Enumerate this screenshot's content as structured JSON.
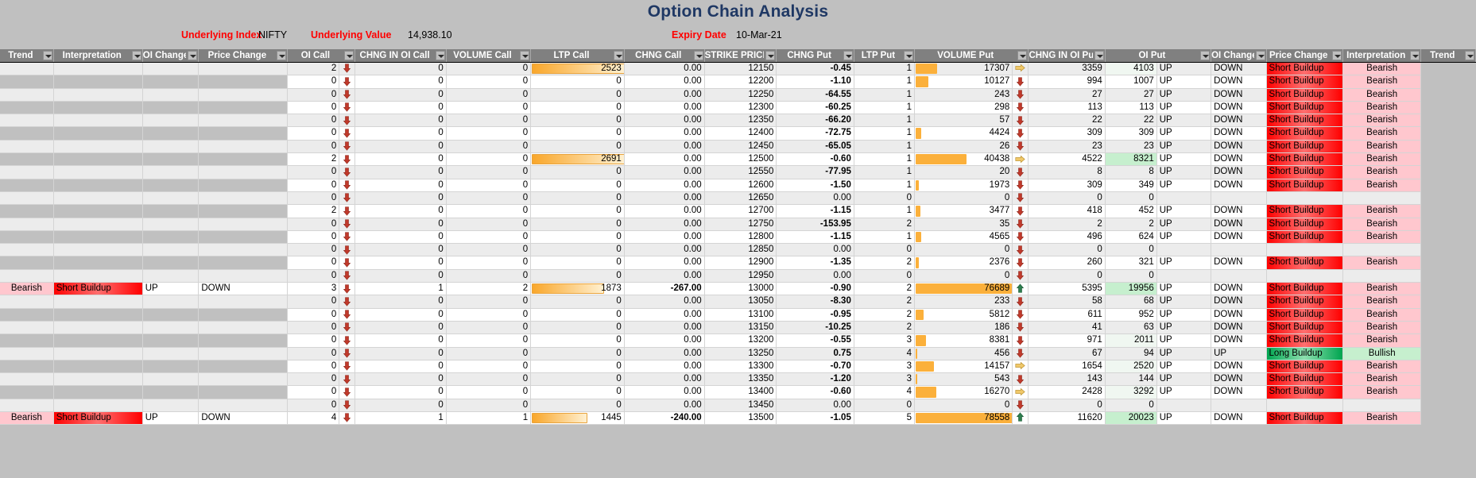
{
  "header": {
    "title": "Option Chain Analysis",
    "underlying_index_label": "Underlying Index",
    "underlying_index_value": "NIFTY",
    "underlying_value_label": "Underlying Value",
    "underlying_value": "14,938.10",
    "expiry_date_label": "Expiry Date",
    "expiry_date_value": "10-Mar-21",
    "title_color": "#1f3864",
    "label_color": "#ff0000"
  },
  "columns": [
    "Trend",
    "Interpretation",
    "OI Change",
    "Price Change",
    "OI Call",
    "CHNG IN OI Call",
    "VOLUME Call",
    "LTP Call",
    "CHNG Call",
    "STRIKE PRICE",
    "CHNG Put",
    "LTP Put",
    "VOLUME Put",
    "CHNG IN OI Put",
    "OI Put",
    "OI Change",
    "Price Change",
    "Interpretation",
    "Trend"
  ],
  "legend": {
    "up_arrow": "up-arrow-icon",
    "down_arrow": "down-arrow-icon",
    "flat_arrow": "flat-arrow-icon"
  },
  "rows": [
    {
      "strike": "12150",
      "l_trend": "",
      "l_interp": "",
      "l_oichg": "",
      "l_pricechg": "",
      "oi_call": "2",
      "oi_call_arrow": "down",
      "chng_oi_call": "0",
      "vol_call": "0",
      "ltp_call": "2523",
      "ltp_call_bar": 100,
      "chng_call": "0.00",
      "chng_put": "-0.45",
      "chng_put_sign": "neg",
      "ltp_put": "1",
      "vol_put": "17307",
      "vol_put_bar": 22,
      "vol_put_arrow": "flat",
      "chng_oi_put": "3359",
      "oi_put": "4103",
      "oi_put_hl": "faint",
      "r_oichg": "UP",
      "r_pricechg": "DOWN",
      "r_interp": "Short Buildup",
      "r_trend": "Bearish"
    },
    {
      "strike": "12200",
      "l_trend": "",
      "l_interp": "",
      "l_oichg": "",
      "l_pricechg": "",
      "oi_call": "0",
      "oi_call_arrow": "down",
      "chng_oi_call": "0",
      "vol_call": "0",
      "ltp_call": "0",
      "ltp_call_bar": 0,
      "chng_call": "0.00",
      "chng_put": "-1.10",
      "chng_put_sign": "neg",
      "ltp_put": "1",
      "vol_put": "10127",
      "vol_put_bar": 13,
      "vol_put_arrow": "down",
      "chng_oi_put": "994",
      "oi_put": "1007",
      "oi_put_hl": "none",
      "r_oichg": "UP",
      "r_pricechg": "DOWN",
      "r_interp": "Short Buildup",
      "r_trend": "Bearish"
    },
    {
      "strike": "12250",
      "l_trend": "",
      "l_interp": "",
      "l_oichg": "",
      "l_pricechg": "",
      "oi_call": "0",
      "oi_call_arrow": "down",
      "chng_oi_call": "0",
      "vol_call": "0",
      "ltp_call": "0",
      "ltp_call_bar": 0,
      "chng_call": "0.00",
      "chng_put": "-64.55",
      "chng_put_sign": "neg",
      "ltp_put": "1",
      "vol_put": "243",
      "vol_put_bar": 0,
      "vol_put_arrow": "down",
      "chng_oi_put": "27",
      "oi_put": "27",
      "oi_put_hl": "none",
      "r_oichg": "UP",
      "r_pricechg": "DOWN",
      "r_interp": "Short Buildup",
      "r_trend": "Bearish"
    },
    {
      "strike": "12300",
      "l_trend": "",
      "l_interp": "",
      "l_oichg": "",
      "l_pricechg": "",
      "oi_call": "0",
      "oi_call_arrow": "down",
      "chng_oi_call": "0",
      "vol_call": "0",
      "ltp_call": "0",
      "ltp_call_bar": 0,
      "chng_call": "0.00",
      "chng_put": "-60.25",
      "chng_put_sign": "neg",
      "ltp_put": "1",
      "vol_put": "298",
      "vol_put_bar": 0,
      "vol_put_arrow": "down",
      "chng_oi_put": "113",
      "oi_put": "113",
      "oi_put_hl": "none",
      "r_oichg": "UP",
      "r_pricechg": "DOWN",
      "r_interp": "Short Buildup",
      "r_trend": "Bearish"
    },
    {
      "strike": "12350",
      "l_trend": "",
      "l_interp": "",
      "l_oichg": "",
      "l_pricechg": "",
      "oi_call": "0",
      "oi_call_arrow": "down",
      "chng_oi_call": "0",
      "vol_call": "0",
      "ltp_call": "0",
      "ltp_call_bar": 0,
      "chng_call": "0.00",
      "chng_put": "-66.20",
      "chng_put_sign": "neg",
      "ltp_put": "1",
      "vol_put": "57",
      "vol_put_bar": 0,
      "vol_put_arrow": "down",
      "chng_oi_put": "22",
      "oi_put": "22",
      "oi_put_hl": "none",
      "r_oichg": "UP",
      "r_pricechg": "DOWN",
      "r_interp": "Short Buildup",
      "r_trend": "Bearish"
    },
    {
      "strike": "12400",
      "l_trend": "",
      "l_interp": "",
      "l_oichg": "",
      "l_pricechg": "",
      "oi_call": "0",
      "oi_call_arrow": "down",
      "chng_oi_call": "0",
      "vol_call": "0",
      "ltp_call": "0",
      "ltp_call_bar": 0,
      "chng_call": "0.00",
      "chng_put": "-72.75",
      "chng_put_sign": "neg",
      "ltp_put": "1",
      "vol_put": "4424",
      "vol_put_bar": 6,
      "vol_put_arrow": "down",
      "chng_oi_put": "309",
      "oi_put": "309",
      "oi_put_hl": "none",
      "r_oichg": "UP",
      "r_pricechg": "DOWN",
      "r_interp": "Short Buildup",
      "r_trend": "Bearish"
    },
    {
      "strike": "12450",
      "l_trend": "",
      "l_interp": "",
      "l_oichg": "",
      "l_pricechg": "",
      "oi_call": "0",
      "oi_call_arrow": "down",
      "chng_oi_call": "0",
      "vol_call": "0",
      "ltp_call": "0",
      "ltp_call_bar": 0,
      "chng_call": "0.00",
      "chng_put": "-65.05",
      "chng_put_sign": "neg",
      "ltp_put": "1",
      "vol_put": "26",
      "vol_put_bar": 0,
      "vol_put_arrow": "down",
      "chng_oi_put": "23",
      "oi_put": "23",
      "oi_put_hl": "none",
      "r_oichg": "UP",
      "r_pricechg": "DOWN",
      "r_interp": "Short Buildup",
      "r_trend": "Bearish"
    },
    {
      "strike": "12500",
      "l_trend": "",
      "l_interp": "",
      "l_oichg": "",
      "l_pricechg": "",
      "oi_call": "2",
      "oi_call_arrow": "down",
      "chng_oi_call": "0",
      "vol_call": "0",
      "ltp_call": "2691",
      "ltp_call_bar": 100,
      "chng_call": "0.00",
      "chng_put": "-0.60",
      "chng_put_sign": "neg",
      "ltp_put": "1",
      "vol_put": "40438",
      "vol_put_bar": 52,
      "vol_put_arrow": "flat",
      "chng_oi_put": "4522",
      "oi_put": "8321",
      "oi_put_hl": "green",
      "r_oichg": "UP",
      "r_pricechg": "DOWN",
      "r_interp": "Short Buildup",
      "r_trend": "Bearish"
    },
    {
      "strike": "12550",
      "l_trend": "",
      "l_interp": "",
      "l_oichg": "",
      "l_pricechg": "",
      "oi_call": "0",
      "oi_call_arrow": "down",
      "chng_oi_call": "0",
      "vol_call": "0",
      "ltp_call": "0",
      "ltp_call_bar": 0,
      "chng_call": "0.00",
      "chng_put": "-77.95",
      "chng_put_sign": "neg",
      "ltp_put": "1",
      "vol_put": "20",
      "vol_put_bar": 0,
      "vol_put_arrow": "down",
      "chng_oi_put": "8",
      "oi_put": "8",
      "oi_put_hl": "none",
      "r_oichg": "UP",
      "r_pricechg": "DOWN",
      "r_interp": "Short Buildup",
      "r_trend": "Bearish"
    },
    {
      "strike": "12600",
      "l_trend": "",
      "l_interp": "",
      "l_oichg": "",
      "l_pricechg": "",
      "oi_call": "0",
      "oi_call_arrow": "down",
      "chng_oi_call": "0",
      "vol_call": "0",
      "ltp_call": "0",
      "ltp_call_bar": 0,
      "chng_call": "0.00",
      "chng_put": "-1.50",
      "chng_put_sign": "neg",
      "ltp_put": "1",
      "vol_put": "1973",
      "vol_put_bar": 3,
      "vol_put_arrow": "down",
      "chng_oi_put": "309",
      "oi_put": "349",
      "oi_put_hl": "none",
      "r_oichg": "UP",
      "r_pricechg": "DOWN",
      "r_interp": "Short Buildup",
      "r_trend": "Bearish"
    },
    {
      "strike": "12650",
      "l_trend": "",
      "l_interp": "",
      "l_oichg": "",
      "l_pricechg": "",
      "oi_call": "0",
      "oi_call_arrow": "down",
      "chng_oi_call": "0",
      "vol_call": "0",
      "ltp_call": "0",
      "ltp_call_bar": 0,
      "chng_call": "0.00",
      "chng_put": "0.00",
      "chng_put_sign": "zero",
      "ltp_put": "0",
      "vol_put": "0",
      "vol_put_bar": 0,
      "vol_put_arrow": "down",
      "chng_oi_put": "0",
      "oi_put": "0",
      "oi_put_hl": "none",
      "r_oichg": "",
      "r_pricechg": "",
      "r_interp": "",
      "r_trend": ""
    },
    {
      "strike": "12700",
      "l_trend": "",
      "l_interp": "",
      "l_oichg": "",
      "l_pricechg": "",
      "oi_call": "2",
      "oi_call_arrow": "down",
      "chng_oi_call": "0",
      "vol_call": "0",
      "ltp_call": "0",
      "ltp_call_bar": 0,
      "chng_call": "0.00",
      "chng_put": "-1.15",
      "chng_put_sign": "neg",
      "ltp_put": "1",
      "vol_put": "3477",
      "vol_put_bar": 5,
      "vol_put_arrow": "down",
      "chng_oi_put": "418",
      "oi_put": "452",
      "oi_put_hl": "none",
      "r_oichg": "UP",
      "r_pricechg": "DOWN",
      "r_interp": "Short Buildup",
      "r_trend": "Bearish"
    },
    {
      "strike": "12750",
      "l_trend": "",
      "l_interp": "",
      "l_oichg": "",
      "l_pricechg": "",
      "oi_call": "0",
      "oi_call_arrow": "down",
      "chng_oi_call": "0",
      "vol_call": "0",
      "ltp_call": "0",
      "ltp_call_bar": 0,
      "chng_call": "0.00",
      "chng_put": "-153.95",
      "chng_put_sign": "neg",
      "ltp_put": "2",
      "vol_put": "35",
      "vol_put_bar": 0,
      "vol_put_arrow": "down",
      "chng_oi_put": "2",
      "oi_put": "2",
      "oi_put_hl": "none",
      "r_oichg": "UP",
      "r_pricechg": "DOWN",
      "r_interp": "Short Buildup",
      "r_trend": "Bearish"
    },
    {
      "strike": "12800",
      "l_trend": "",
      "l_interp": "",
      "l_oichg": "",
      "l_pricechg": "",
      "oi_call": "0",
      "oi_call_arrow": "down",
      "chng_oi_call": "0",
      "vol_call": "0",
      "ltp_call": "0",
      "ltp_call_bar": 0,
      "chng_call": "0.00",
      "chng_put": "-1.15",
      "chng_put_sign": "neg",
      "ltp_put": "1",
      "vol_put": "4565",
      "vol_put_bar": 6,
      "vol_put_arrow": "down",
      "chng_oi_put": "496",
      "oi_put": "624",
      "oi_put_hl": "none",
      "r_oichg": "UP",
      "r_pricechg": "DOWN",
      "r_interp": "Short Buildup",
      "r_trend": "Bearish"
    },
    {
      "strike": "12850",
      "l_trend": "",
      "l_interp": "",
      "l_oichg": "",
      "l_pricechg": "",
      "oi_call": "0",
      "oi_call_arrow": "down",
      "chng_oi_call": "0",
      "vol_call": "0",
      "ltp_call": "0",
      "ltp_call_bar": 0,
      "chng_call": "0.00",
      "chng_put": "0.00",
      "chng_put_sign": "zero",
      "ltp_put": "0",
      "vol_put": "0",
      "vol_put_bar": 0,
      "vol_put_arrow": "down",
      "chng_oi_put": "0",
      "oi_put": "0",
      "oi_put_hl": "none",
      "r_oichg": "",
      "r_pricechg": "",
      "r_interp": "",
      "r_trend": ""
    },
    {
      "strike": "12900",
      "l_trend": "",
      "l_interp": "",
      "l_oichg": "",
      "l_pricechg": "",
      "oi_call": "0",
      "oi_call_arrow": "down",
      "chng_oi_call": "0",
      "vol_call": "0",
      "ltp_call": "0",
      "ltp_call_bar": 0,
      "chng_call": "0.00",
      "chng_put": "-1.35",
      "chng_put_sign": "neg",
      "ltp_put": "2",
      "vol_put": "2376",
      "vol_put_bar": 3,
      "vol_put_arrow": "down",
      "chng_oi_put": "260",
      "oi_put": "321",
      "oi_put_hl": "none",
      "r_oichg": "UP",
      "r_pricechg": "DOWN",
      "r_interp": "Short Buildup",
      "r_trend": "Bearish"
    },
    {
      "strike": "12950",
      "l_trend": "",
      "l_interp": "",
      "l_oichg": "",
      "l_pricechg": "",
      "oi_call": "0",
      "oi_call_arrow": "down",
      "chng_oi_call": "0",
      "vol_call": "0",
      "ltp_call": "0",
      "ltp_call_bar": 0,
      "chng_call": "0.00",
      "chng_put": "0.00",
      "chng_put_sign": "zero",
      "ltp_put": "0",
      "vol_put": "0",
      "vol_put_bar": 0,
      "vol_put_arrow": "down",
      "chng_oi_put": "0",
      "oi_put": "0",
      "oi_put_hl": "none",
      "r_oichg": "",
      "r_pricechg": "",
      "r_interp": "",
      "r_trend": ""
    },
    {
      "strike": "13000",
      "l_trend": "Bearish",
      "l_interp": "Short Buildup",
      "l_oichg": "UP",
      "l_pricechg": "DOWN",
      "oi_call": "3",
      "oi_call_arrow": "down",
      "chng_oi_call": "1",
      "vol_call": "2",
      "ltp_call": "1873",
      "ltp_call_bar": 78,
      "chng_call": "-267.00",
      "chng_call_sign": "neg",
      "chng_put": "-0.90",
      "chng_put_sign": "neg",
      "ltp_put": "2",
      "vol_put": "76689",
      "vol_put_bar": 99,
      "vol_put_arrow": "up",
      "chng_oi_put": "5395",
      "oi_put": "19956",
      "oi_put_hl": "green",
      "r_oichg": "UP",
      "r_pricechg": "DOWN",
      "r_interp": "Short Buildup",
      "r_trend": "Bearish"
    },
    {
      "strike": "13050",
      "l_trend": "",
      "l_interp": "",
      "l_oichg": "",
      "l_pricechg": "",
      "oi_call": "0",
      "oi_call_arrow": "down",
      "chng_oi_call": "0",
      "vol_call": "0",
      "ltp_call": "0",
      "ltp_call_bar": 0,
      "chng_call": "0.00",
      "chng_put": "-8.30",
      "chng_put_sign": "neg",
      "ltp_put": "2",
      "vol_put": "233",
      "vol_put_bar": 0,
      "vol_put_arrow": "down",
      "chng_oi_put": "58",
      "oi_put": "68",
      "oi_put_hl": "none",
      "r_oichg": "UP",
      "r_pricechg": "DOWN",
      "r_interp": "Short Buildup",
      "r_trend": "Bearish"
    },
    {
      "strike": "13100",
      "l_trend": "",
      "l_interp": "",
      "l_oichg": "",
      "l_pricechg": "",
      "oi_call": "0",
      "oi_call_arrow": "down",
      "chng_oi_call": "0",
      "vol_call": "0",
      "ltp_call": "0",
      "ltp_call_bar": 0,
      "chng_call": "0.00",
      "chng_put": "-0.95",
      "chng_put_sign": "neg",
      "ltp_put": "2",
      "vol_put": "5812",
      "vol_put_bar": 8,
      "vol_put_arrow": "down",
      "chng_oi_put": "611",
      "oi_put": "952",
      "oi_put_hl": "none",
      "r_oichg": "UP",
      "r_pricechg": "DOWN",
      "r_interp": "Short Buildup",
      "r_trend": "Bearish"
    },
    {
      "strike": "13150",
      "l_trend": "",
      "l_interp": "",
      "l_oichg": "",
      "l_pricechg": "",
      "oi_call": "0",
      "oi_call_arrow": "down",
      "chng_oi_call": "0",
      "vol_call": "0",
      "ltp_call": "0",
      "ltp_call_bar": 0,
      "chng_call": "0.00",
      "chng_put": "-10.25",
      "chng_put_sign": "neg",
      "ltp_put": "2",
      "vol_put": "186",
      "vol_put_bar": 0,
      "vol_put_arrow": "down",
      "chng_oi_put": "41",
      "oi_put": "63",
      "oi_put_hl": "none",
      "r_oichg": "UP",
      "r_pricechg": "DOWN",
      "r_interp": "Short Buildup",
      "r_trend": "Bearish"
    },
    {
      "strike": "13200",
      "l_trend": "",
      "l_interp": "",
      "l_oichg": "",
      "l_pricechg": "",
      "oi_call": "0",
      "oi_call_arrow": "down",
      "chng_oi_call": "0",
      "vol_call": "0",
      "ltp_call": "0",
      "ltp_call_bar": 0,
      "chng_call": "0.00",
      "chng_put": "-0.55",
      "chng_put_sign": "neg",
      "ltp_put": "3",
      "vol_put": "8381",
      "vol_put_bar": 11,
      "vol_put_arrow": "down",
      "chng_oi_put": "971",
      "oi_put": "2011",
      "oi_put_hl": "faint",
      "r_oichg": "UP",
      "r_pricechg": "DOWN",
      "r_interp": "Short Buildup",
      "r_trend": "Bearish"
    },
    {
      "strike": "13250",
      "l_trend": "",
      "l_interp": "",
      "l_oichg": "",
      "l_pricechg": "",
      "oi_call": "0",
      "oi_call_arrow": "down",
      "chng_oi_call": "0",
      "vol_call": "0",
      "ltp_call": "0",
      "ltp_call_bar": 0,
      "chng_call": "0.00",
      "chng_put": "0.75",
      "chng_put_sign": "pos",
      "ltp_put": "4",
      "vol_put": "456",
      "vol_put_bar": 1,
      "vol_put_arrow": "down",
      "chng_oi_put": "67",
      "oi_put": "94",
      "oi_put_hl": "none",
      "r_oichg": "UP",
      "r_pricechg": "UP",
      "r_interp": "Long Buildup",
      "r_trend": "Bullish"
    },
    {
      "strike": "13300",
      "l_trend": "",
      "l_interp": "",
      "l_oichg": "",
      "l_pricechg": "",
      "oi_call": "0",
      "oi_call_arrow": "down",
      "chng_oi_call": "0",
      "vol_call": "0",
      "ltp_call": "0",
      "ltp_call_bar": 0,
      "chng_call": "0.00",
      "chng_put": "-0.70",
      "chng_put_sign": "neg",
      "ltp_put": "3",
      "vol_put": "14157",
      "vol_put_bar": 19,
      "vol_put_arrow": "flat",
      "chng_oi_put": "1654",
      "oi_put": "2520",
      "oi_put_hl": "faint",
      "r_oichg": "UP",
      "r_pricechg": "DOWN",
      "r_interp": "Short Buildup",
      "r_trend": "Bearish"
    },
    {
      "strike": "13350",
      "l_trend": "",
      "l_interp": "",
      "l_oichg": "",
      "l_pricechg": "",
      "oi_call": "0",
      "oi_call_arrow": "down",
      "chng_oi_call": "0",
      "vol_call": "0",
      "ltp_call": "0",
      "ltp_call_bar": 0,
      "chng_call": "0.00",
      "chng_put": "-1.20",
      "chng_put_sign": "neg",
      "ltp_put": "3",
      "vol_put": "543",
      "vol_put_bar": 1,
      "vol_put_arrow": "down",
      "chng_oi_put": "143",
      "oi_put": "144",
      "oi_put_hl": "none",
      "r_oichg": "UP",
      "r_pricechg": "DOWN",
      "r_interp": "Short Buildup",
      "r_trend": "Bearish"
    },
    {
      "strike": "13400",
      "l_trend": "",
      "l_interp": "",
      "l_oichg": "",
      "l_pricechg": "",
      "oi_call": "0",
      "oi_call_arrow": "down",
      "chng_oi_call": "0",
      "vol_call": "0",
      "ltp_call": "0",
      "ltp_call_bar": 0,
      "chng_call": "0.00",
      "chng_put": "-0.60",
      "chng_put_sign": "neg",
      "ltp_put": "4",
      "vol_put": "16270",
      "vol_put_bar": 21,
      "vol_put_arrow": "flat",
      "chng_oi_put": "2428",
      "oi_put": "3292",
      "oi_put_hl": "faint",
      "r_oichg": "UP",
      "r_pricechg": "DOWN",
      "r_interp": "Short Buildup",
      "r_trend": "Bearish"
    },
    {
      "strike": "13450",
      "l_trend": "",
      "l_interp": "",
      "l_oichg": "",
      "l_pricechg": "",
      "oi_call": "0",
      "oi_call_arrow": "down",
      "chng_oi_call": "0",
      "vol_call": "0",
      "ltp_call": "0",
      "ltp_call_bar": 0,
      "chng_call": "0.00",
      "chng_put": "0.00",
      "chng_put_sign": "zero",
      "ltp_put": "0",
      "vol_put": "0",
      "vol_put_bar": 0,
      "vol_put_arrow": "down",
      "chng_oi_put": "0",
      "oi_put": "0",
      "oi_put_hl": "none",
      "r_oichg": "",
      "r_pricechg": "",
      "r_interp": "",
      "r_trend": ""
    },
    {
      "strike": "13500",
      "l_trend": "Bearish",
      "l_interp": "Short Buildup",
      "l_oichg": "UP",
      "l_pricechg": "DOWN",
      "oi_call": "4",
      "oi_call_arrow": "down",
      "chng_oi_call": "1",
      "vol_call": "1",
      "ltp_call": "1445",
      "ltp_call_bar": 60,
      "chng_call": "-240.00",
      "chng_call_sign": "neg",
      "chng_put": "-1.05",
      "chng_put_sign": "neg",
      "ltp_put": "5",
      "vol_put": "78558",
      "vol_put_bar": 100,
      "vol_put_arrow": "up",
      "chng_oi_put": "11620",
      "oi_put": "20023",
      "oi_put_hl": "green",
      "r_oichg": "UP",
      "r_pricechg": "DOWN",
      "r_interp": "Short Buildup",
      "r_trend": "Bearish"
    }
  ]
}
